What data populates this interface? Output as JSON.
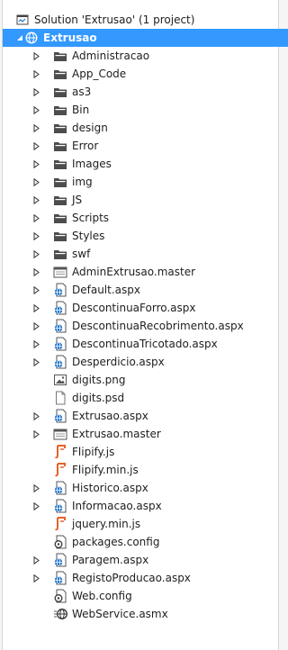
{
  "solution_label": "Solution 'Extrusao' (1 project)",
  "project_label": "Extrusao",
  "items": [
    {
      "label": "Administracao",
      "icon": "folder-icon",
      "expandable": true
    },
    {
      "label": "App_Code",
      "icon": "folder-icon",
      "expandable": true
    },
    {
      "label": "as3",
      "icon": "folder-icon",
      "expandable": true
    },
    {
      "label": "Bin",
      "icon": "folder-icon",
      "expandable": true
    },
    {
      "label": "design",
      "icon": "folder-icon",
      "expandable": true
    },
    {
      "label": "Error",
      "icon": "folder-icon",
      "expandable": true
    },
    {
      "label": "Images",
      "icon": "folder-icon",
      "expandable": true
    },
    {
      "label": "img",
      "icon": "folder-icon",
      "expandable": true
    },
    {
      "label": "JS",
      "icon": "folder-icon",
      "expandable": true
    },
    {
      "label": "Scripts",
      "icon": "folder-icon",
      "expandable": true
    },
    {
      "label": "Styles",
      "icon": "folder-icon",
      "expandable": true
    },
    {
      "label": "swf",
      "icon": "folder-icon",
      "expandable": true
    },
    {
      "label": "AdminExtrusao.master",
      "icon": "master-page-icon",
      "expandable": true
    },
    {
      "label": "Default.aspx",
      "icon": "aspx-page-icon",
      "expandable": true
    },
    {
      "label": "DescontinuaForro.aspx",
      "icon": "aspx-page-icon",
      "expandable": true
    },
    {
      "label": "DescontinuaRecobrimento.aspx",
      "icon": "aspx-page-icon",
      "expandable": true
    },
    {
      "label": "DescontinuaTricotado.aspx",
      "icon": "aspx-page-icon",
      "expandable": true
    },
    {
      "label": "Desperdicio.aspx",
      "icon": "aspx-page-icon",
      "expandable": true
    },
    {
      "label": "digits.png",
      "icon": "image-file-icon",
      "expandable": false
    },
    {
      "label": "digits.psd",
      "icon": "blank-file-icon",
      "expandable": false
    },
    {
      "label": "Extrusao.aspx",
      "icon": "aspx-page-icon",
      "expandable": true
    },
    {
      "label": "Extrusao.master",
      "icon": "master-page-icon",
      "expandable": true
    },
    {
      "label": "Flipify.js",
      "icon": "javascript-file-icon",
      "expandable": false
    },
    {
      "label": "Flipify.min.js",
      "icon": "javascript-file-icon",
      "expandable": false
    },
    {
      "label": "Historico.aspx",
      "icon": "aspx-page-icon",
      "expandable": true
    },
    {
      "label": "Informacao.aspx",
      "icon": "aspx-page-icon",
      "expandable": true
    },
    {
      "label": "jquery.min.js",
      "icon": "javascript-file-icon",
      "expandable": false
    },
    {
      "label": "packages.config",
      "icon": "config-file-icon",
      "expandable": false
    },
    {
      "label": "Paragem.aspx",
      "icon": "aspx-page-icon",
      "expandable": true
    },
    {
      "label": "RegistoProducao.aspx",
      "icon": "aspx-page-icon",
      "expandable": true
    },
    {
      "label": "Web.config",
      "icon": "config-file-icon",
      "expandable": false
    },
    {
      "label": "WebService.asmx",
      "icon": "web-service-icon",
      "expandable": false
    }
  ],
  "colors": {
    "selection": "#3399ff",
    "folder": "#4d4d4d",
    "aspx": "#1e72c8",
    "javascript": "#e8622b"
  }
}
